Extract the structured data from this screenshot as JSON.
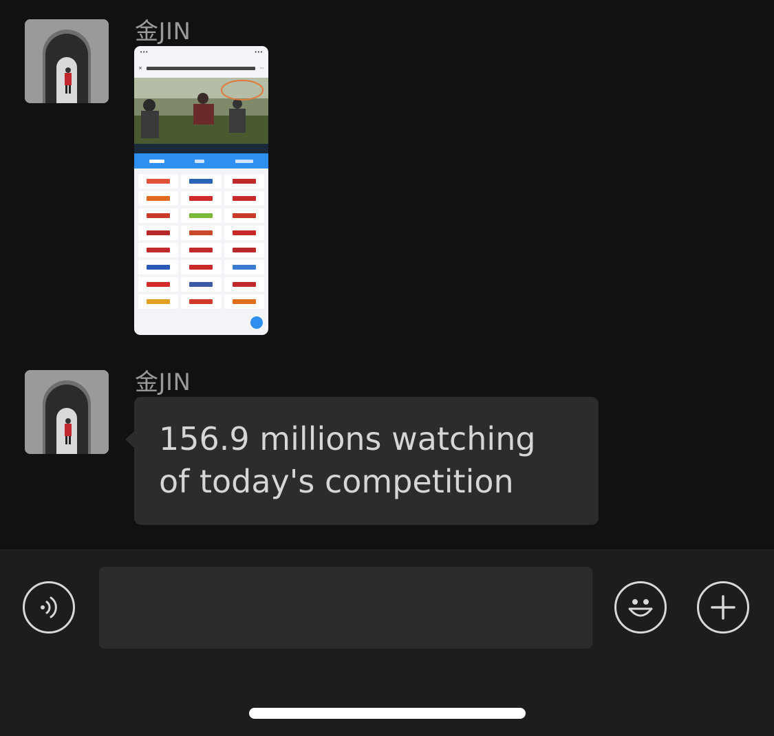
{
  "messages": [
    {
      "sender": "金JIN",
      "type": "image"
    },
    {
      "sender": "金JIN",
      "type": "text",
      "text": "156.9 millions watching of today's competition"
    }
  ],
  "colors": {
    "background": "#111111",
    "bubble": "#2c2c2c",
    "input_bar": "#1d1d1d",
    "accent_blue": "#2f8ff0"
  },
  "icons": {
    "voice": "voice-icon",
    "emoji": "emoji-icon",
    "add": "plus-icon"
  }
}
